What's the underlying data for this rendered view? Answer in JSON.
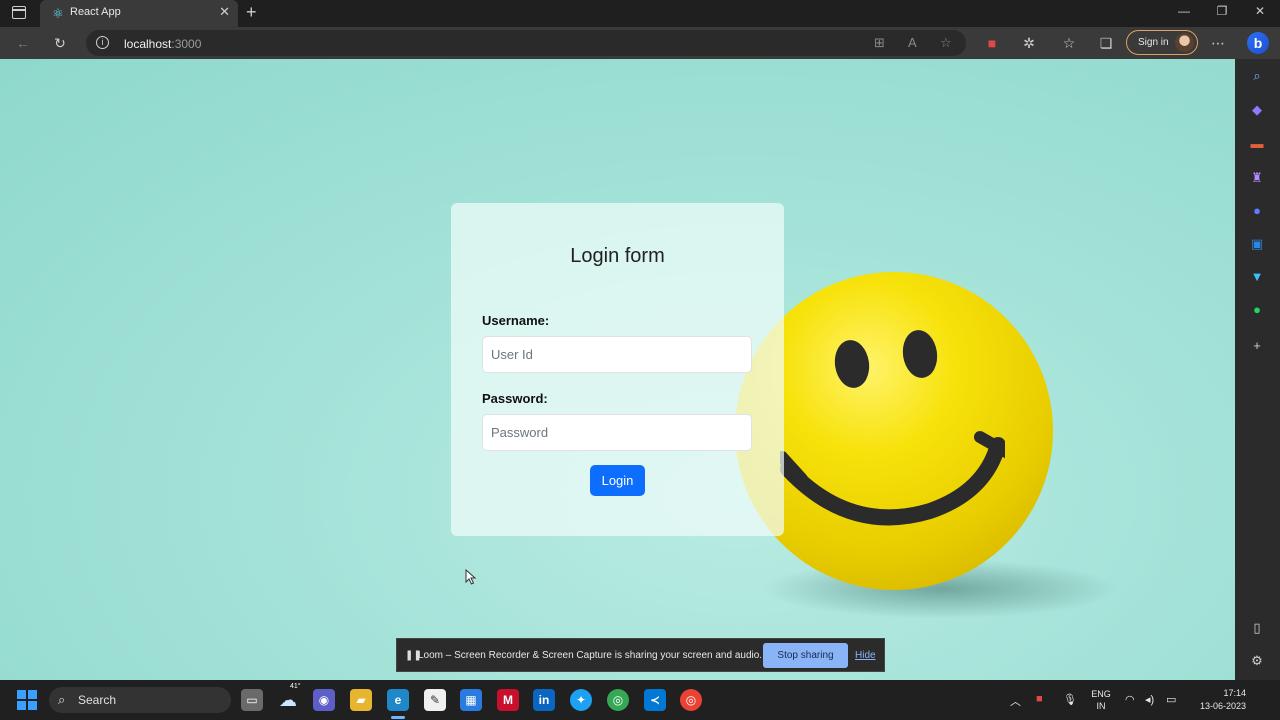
{
  "browser": {
    "tab_title": "React App",
    "url_host": "localhost",
    "url_port": ":3000",
    "signin_label": "Sign in"
  },
  "page": {
    "form_title": "Login form",
    "username_label": "Username:",
    "username_placeholder": "User Id",
    "password_label": "Password:",
    "password_placeholder": "Password",
    "login_button": "Login"
  },
  "loom": {
    "message": "Loom – Screen Recorder & Screen Capture is sharing your screen and audio.",
    "stop_label": "Stop sharing",
    "hide_label": "Hide"
  },
  "taskbar": {
    "search_label": "Search",
    "weather_temp": "41°",
    "lang_line1": "ENG",
    "lang_line2": "IN",
    "time": "17:14",
    "date": "13-06-2023"
  },
  "colors": {
    "primary_button": "#0d6efd",
    "loom_button": "#8ab4f8",
    "page_background": "#a3e2d8"
  }
}
